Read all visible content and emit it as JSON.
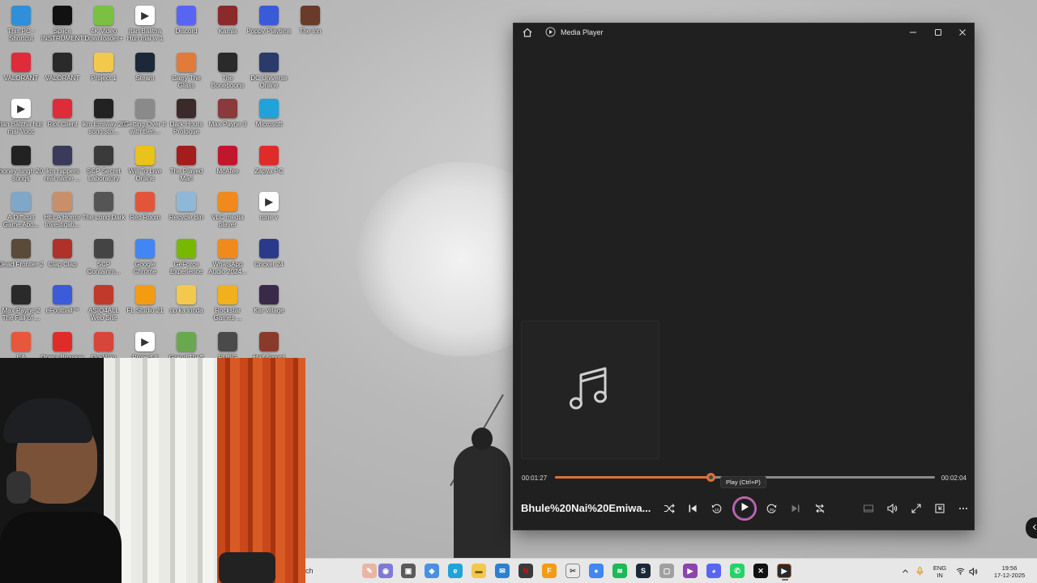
{
  "desktop": {
    "icons": [
      {
        "label": "This PC - Shortcut",
        "icon": "monitor-icon",
        "color": "#2f8fd8"
      },
      {
        "label": "VALORANT",
        "icon": "valorant-icon",
        "color": "#e02b3a"
      },
      {
        "label": "Itan Balitha hun mai Vocc",
        "icon": "media-file-icon",
        "color": "#ffffff"
      },
      {
        "label": "honey singh 20 songs",
        "icon": "film-icon",
        "color": "#222222"
      },
      {
        "label": "A Difficult Game Abo...",
        "icon": "game-icon",
        "color": "#7ea7c8"
      },
      {
        "label": "Dead Frontier 2",
        "icon": "game-icon",
        "color": "#5a4a3a"
      },
      {
        "label": "Max Payne 2 The Fall of ...",
        "icon": "game-icon",
        "color": "#2a2a2a"
      },
      {
        "label": "EA",
        "icon": "ea-icon",
        "color": "#e8563b"
      },
      {
        "label": "Splice INSTRUMENT",
        "icon": "splice-icon",
        "color": "#111111"
      },
      {
        "label": "VALORANT",
        "icon": "valorant-icon",
        "color": "#2a2a2a"
      },
      {
        "label": "Riot Client",
        "icon": "riot-icon",
        "color": "#e02b3a"
      },
      {
        "label": "ikm rappers real name ...",
        "icon": "film-icon",
        "color": "#3a3a5a"
      },
      {
        "label": "HELA Horror Investigati...",
        "icon": "game-icon",
        "color": "#c98f6a"
      },
      {
        "label": "Clap Clap",
        "icon": "game-icon",
        "color": "#b0312a"
      },
      {
        "label": "eFootball™",
        "icon": "game-icon",
        "color": "#3b5bd8"
      },
      {
        "label": "Opera Browser",
        "icon": "opera-icon",
        "color": "#e02b2b"
      },
      {
        "label": "4K Video Downloader+",
        "icon": "android-icon",
        "color": "#7bc043"
      },
      {
        "label": "Project 1",
        "icon": "folder-icon",
        "color": "#f2c94c"
      },
      {
        "label": "ikm Emiway 20 song sto...",
        "icon": "film-icon",
        "color": "#222222"
      },
      {
        "label": "SCP Secret Laboratory",
        "icon": "game-icon",
        "color": "#3a3a3a"
      },
      {
        "label": "The Long Dark",
        "icon": "axe-icon",
        "color": "#555555"
      },
      {
        "label": "SCP Containm...",
        "icon": "game-icon",
        "color": "#444444"
      },
      {
        "label": "ASIO4ALL Web Site",
        "icon": "web-icon",
        "color": "#c0392b"
      },
      {
        "label": "DosWan",
        "icon": "app-icon",
        "color": "#d8453a"
      },
      {
        "label": "Itan Balitha Hun mai w 1",
        "icon": "media-file-icon",
        "color": "#ffffff"
      },
      {
        "label": "Steam",
        "icon": "steam-icon",
        "color": "#1b2838"
      },
      {
        "label": "Getting Over It with Ben...",
        "icon": "game-icon",
        "color": "#8a8a8a"
      },
      {
        "label": "Will To Live Online",
        "icon": "radiation-icon",
        "color": "#e9c21a"
      },
      {
        "label": "Rec Room",
        "icon": "recroom-icon",
        "color": "#e2553a"
      },
      {
        "label": "Google Chrome",
        "icon": "chrome-icon",
        "color": "#4285f4"
      },
      {
        "label": "FL Studio 21",
        "icon": "flstudio-icon",
        "color": "#f39c12"
      },
      {
        "label": "Project 8",
        "icon": "media-file-icon",
        "color": "#ffffff"
      },
      {
        "label": "Discord",
        "icon": "discord-icon",
        "color": "#5865f2"
      },
      {
        "label": "Carry The Glass",
        "icon": "game-icon",
        "color": "#e07b39"
      },
      {
        "label": "Dark Hours Prologue",
        "icon": "game-icon",
        "color": "#3a2a2a"
      },
      {
        "label": "The Played Man",
        "icon": "game-icon",
        "color": "#a31d1d"
      },
      {
        "label": "Recycle Bin",
        "icon": "recycle-bin-icon",
        "color": "#8fb8d8"
      },
      {
        "label": "GeForce Experience",
        "icon": "nvidia-icon",
        "color": "#76b900"
      },
      {
        "label": "op ka londa",
        "icon": "folder-icon",
        "color": "#f2c94c"
      },
      {
        "label": "Grand Theft Auto V",
        "icon": "gta-icon",
        "color": "#6aa84f"
      },
      {
        "label": "Kamla",
        "icon": "game-icon",
        "color": "#8a2a2a"
      },
      {
        "label": "The Boneboons",
        "icon": "game-icon",
        "color": "#2a2a2a"
      },
      {
        "label": "Max Payne 3",
        "icon": "game-icon",
        "color": "#8a3a3a"
      },
      {
        "label": "McAfee",
        "icon": "mcafee-icon",
        "color": "#c0172d"
      },
      {
        "label": "VLC media player",
        "icon": "vlc-icon",
        "color": "#f08a1c"
      },
      {
        "label": "WhatsApp Audio 2024...",
        "icon": "vlc-icon",
        "color": "#f08a1c"
      },
      {
        "label": "Rockstar Games ...",
        "icon": "rockstar-icon",
        "color": "#f2b01e"
      },
      {
        "label": "PUBG BATTLEGR...",
        "icon": "pubg-icon",
        "color": "#4a4a4a"
      },
      {
        "label": "Poppy Playtime",
        "icon": "game-icon",
        "color": "#3a5bd8"
      },
      {
        "label": "DC Universe Online",
        "icon": "game-icon",
        "color": "#2a3a6a"
      },
      {
        "label": "Microsoft",
        "icon": "edge-icon",
        "color": "#1fa3d9"
      },
      {
        "label": "Zapya PC",
        "icon": "app-icon",
        "color": "#e02b2b"
      },
      {
        "label": "rune v",
        "icon": "media-file-icon",
        "color": "#ffffff"
      },
      {
        "label": "Cricket 24",
        "icon": "game-icon",
        "color": "#2a3a8a"
      },
      {
        "label": "Kar village",
        "icon": "game-icon",
        "color": "#3a2a4a"
      },
      {
        "label": "Half Sword",
        "icon": "game-icon",
        "color": "#8a3a2a"
      },
      {
        "label": "The Inn",
        "icon": "game-icon",
        "color": "#6a3a2a"
      }
    ]
  },
  "player": {
    "title": "Media Player",
    "track_title": "Bhule%20Nai%20Emiwa...",
    "time_current": "00:01:27",
    "time_total": "00:02:04",
    "progress": 0.41,
    "tooltip": "Play (Ctrl+P)",
    "accent": "#d9733a"
  },
  "taskbar": {
    "search_text": "ch",
    "lang_top": "ENG",
    "lang_bottom": "IN",
    "time": "19:56",
    "date": "17-12-2025"
  }
}
